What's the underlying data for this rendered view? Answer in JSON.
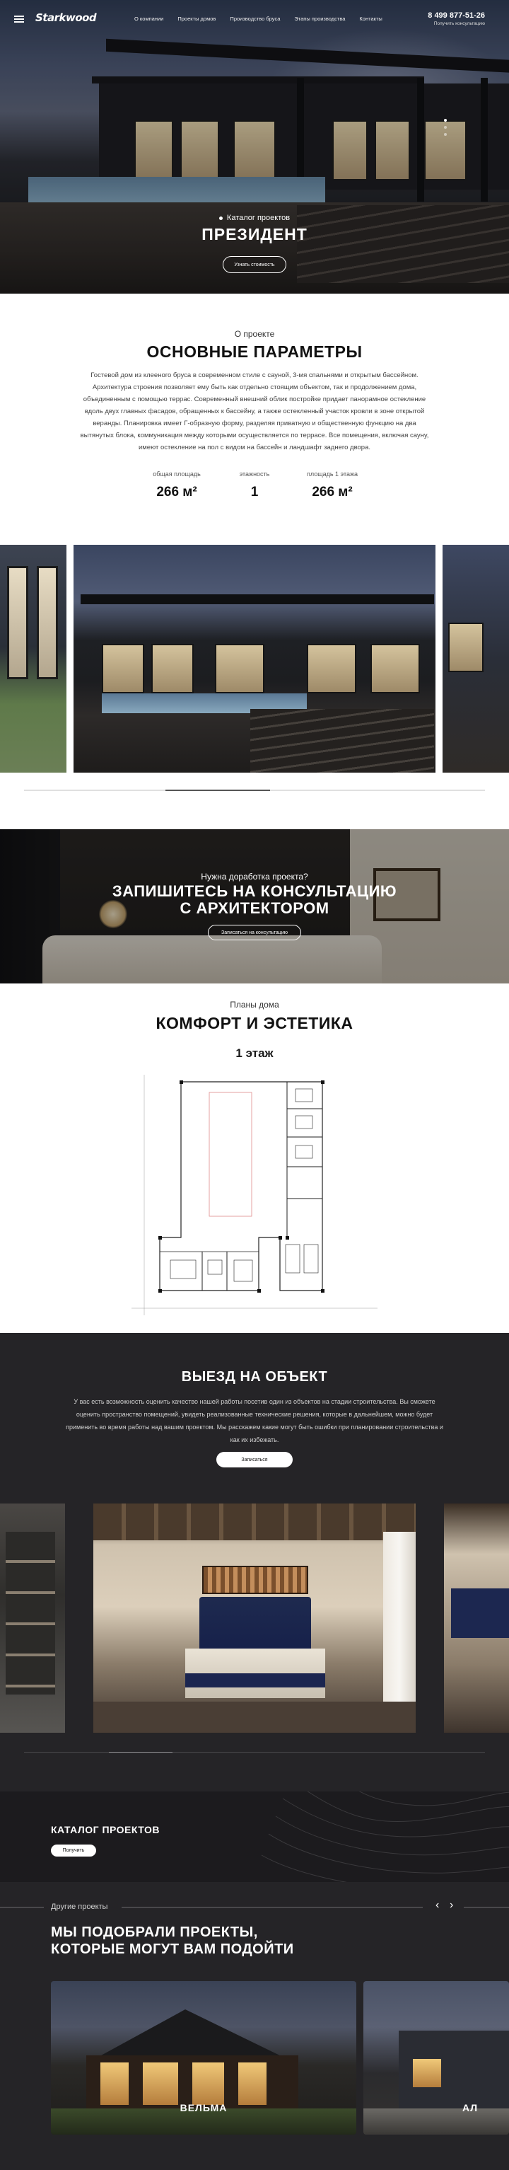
{
  "header": {
    "logo": "Starkwood",
    "nav": [
      "О компании",
      "Проекты домов",
      "Производство бруса",
      "Этапы производства",
      "Контакты"
    ],
    "phone": "8 499 877-51-26",
    "phone_sub": "Получить консультацию"
  },
  "hero": {
    "category": "Каталог проектов",
    "title": "ПРЕЗИДЕНТ",
    "button": "Узнать стоимость"
  },
  "about": {
    "eyebrow": "О проекте",
    "title": "ОСНОВНЫЕ ПАРАМЕТРЫ",
    "text": "Гостевой дом из клееного бруса в современном стиле с сауной, 3-мя спальнями и открытым бассейном. Архитектура строения позволяет ему быть как отдельно стоящим объектом, так и продолжением дома, объединенным с помощью террас. Современный внешний облик постройке придает панорамное остекление вдоль двух главных фасадов, обращенных к бассейну, а также остекленный участок кровли в зоне открытой веранды. Планировка имеет Г-образную форму, разделяя приватную и общественную функцию на два вытянутых блока, коммуникация между которыми осуществляется по террасе. Все помещения, включая сауну, имеют остекление на пол с видом на бассейн и ландшафт заднего двора.",
    "params": [
      {
        "label": "общая площадь",
        "value": "266 м²"
      },
      {
        "label": "этажность",
        "value": "1"
      },
      {
        "label": "площадь 1 этажа",
        "value": "266 м²"
      }
    ]
  },
  "consult": {
    "eyebrow": "Нужна доработка проекта?",
    "title_line1": "ЗАПИШИТЕСЬ НА КОНСУЛЬТАЦИЮ",
    "title_line2": "С АРХИТЕКТОРОМ",
    "button": "Записаться на консультацию"
  },
  "plans": {
    "eyebrow": "Планы дома",
    "title": "КОМФОРТ И ЭСТЕТИКА",
    "floor": "1 этаж"
  },
  "visit": {
    "title": "ВЫЕЗД НА ОБЪЕКТ",
    "text": "У вас есть возможность оценить качество нашей работы посетив один из объектов на стадии строительства. Вы сможете оценить пространство помещений, увидеть реализованные технические решения, которые в дальнейшем, можно будет применить во время работы над вашим проектом. Мы расскажем какие могут быть ошибки при планировании строительства и как их избежать.",
    "button": "Записаться"
  },
  "catalog": {
    "title": "КАТАЛОГ ПРОЕКТОВ",
    "button": "Получить"
  },
  "other": {
    "eyebrow": "Другие проекты",
    "prev": "‹",
    "next": "›",
    "title_line1": "МЫ ПОДОБРАЛИ ПРОЕКТЫ,",
    "title_line2": "КОТОРЫЕ МОГУТ ВАМ ПОДОЙТИ",
    "cards": [
      "ВЕЛЬМА",
      "АЛ"
    ]
  }
}
